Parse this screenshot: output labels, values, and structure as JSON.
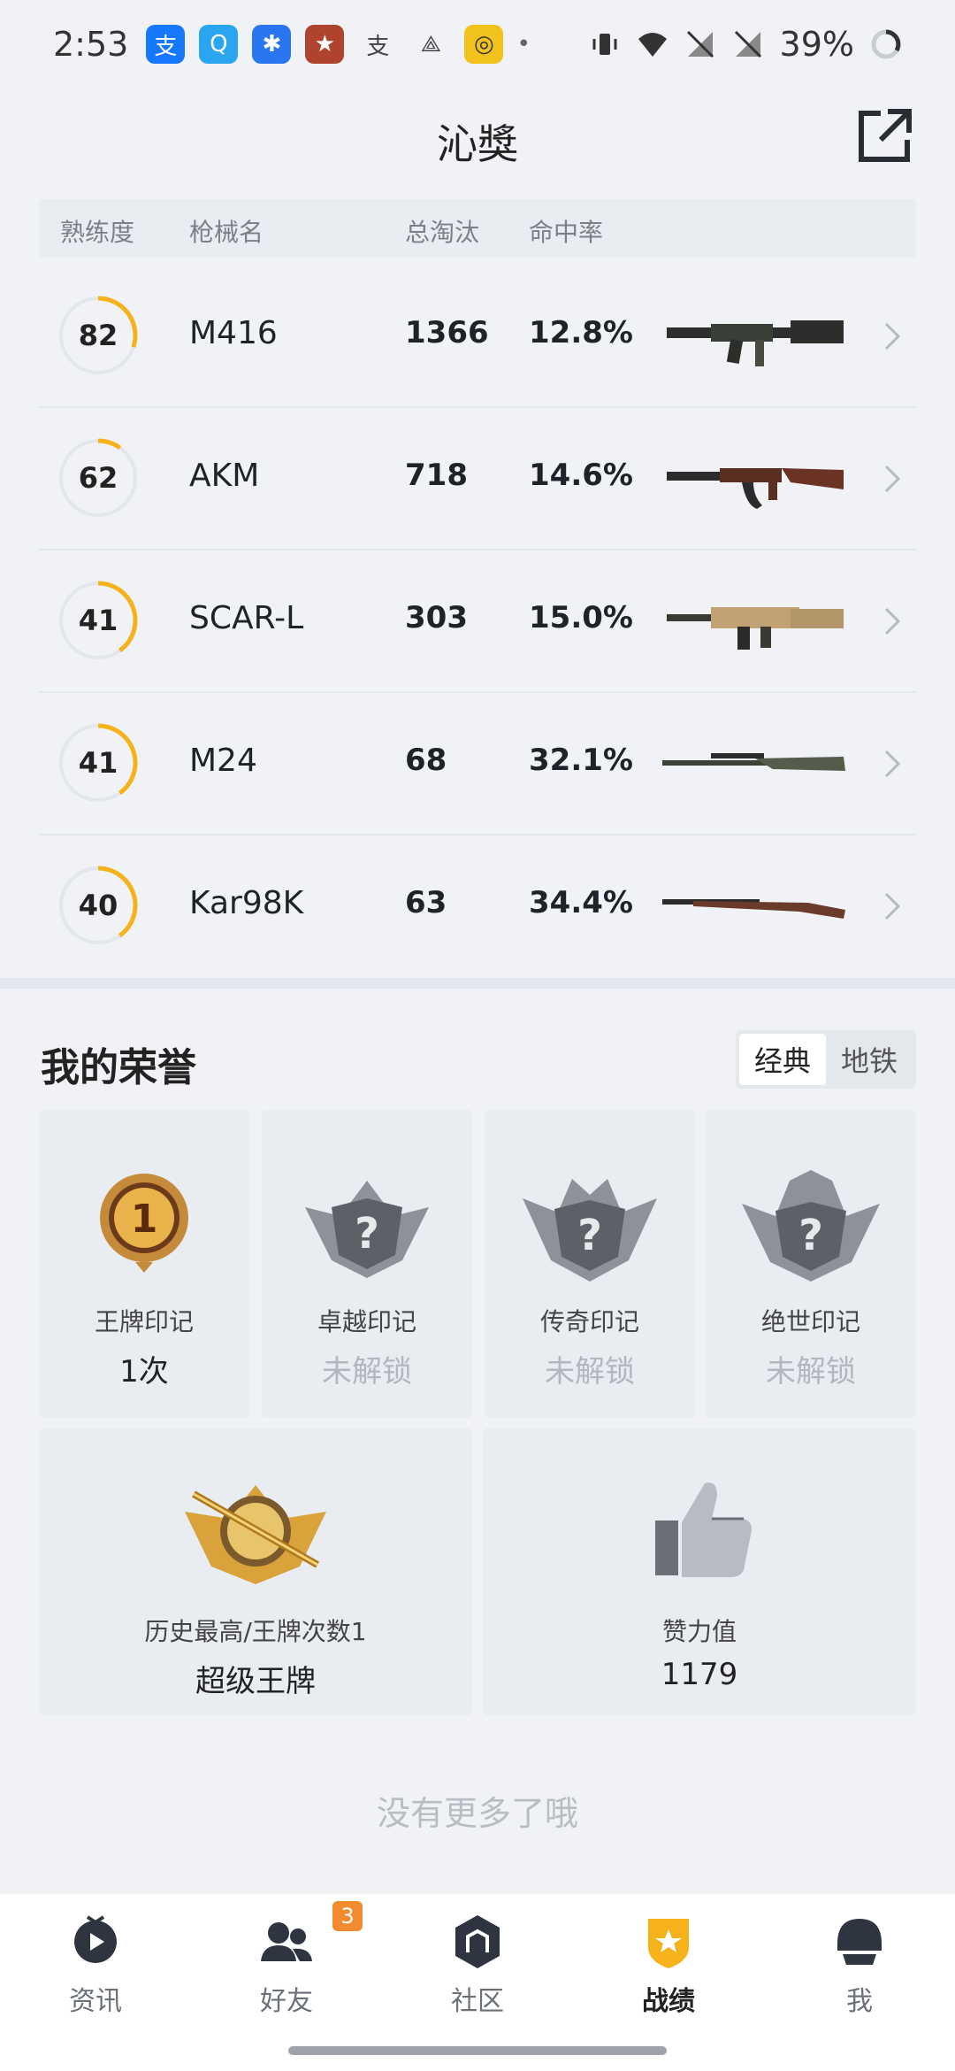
{
  "status_bar": {
    "time": "2:53",
    "battery": "39%"
  },
  "header": {
    "title": "沁獎"
  },
  "table": {
    "headers": {
      "proficiency": "熟练度",
      "gun_name": "枪械名",
      "total_kills": "总淘汰",
      "hit_rate": "命中率"
    },
    "rows": [
      {
        "proficiency": "82",
        "name": "M416",
        "kills": "1366",
        "rate": "12.8%",
        "ring_fraction": 0.3
      },
      {
        "proficiency": "62",
        "name": "AKM",
        "kills": "718",
        "rate": "14.6%",
        "ring_fraction": 0.1
      },
      {
        "proficiency": "41",
        "name": "SCAR-L",
        "kills": "303",
        "rate": "15.0%",
        "ring_fraction": 0.4
      },
      {
        "proficiency": "41",
        "name": "M24",
        "kills": "68",
        "rate": "32.1%",
        "ring_fraction": 0.4
      },
      {
        "proficiency": "40",
        "name": "Kar98K",
        "kills": "63",
        "rate": "34.4%",
        "ring_fraction": 0.4
      }
    ]
  },
  "honor": {
    "title": "我的荣誉",
    "tabs": [
      "经典",
      "地铁"
    ],
    "active_tab": "经典",
    "marks": [
      {
        "label": "王牌印记",
        "value": "1次",
        "locked": false
      },
      {
        "label": "卓越印记",
        "value": "未解锁",
        "locked": true
      },
      {
        "label": "传奇印记",
        "value": "未解锁",
        "locked": true
      },
      {
        "label": "绝世印记",
        "value": "未解锁",
        "locked": true
      }
    ],
    "highest": {
      "label": "历史最高/王牌次数1",
      "value": "超级王牌"
    },
    "likes": {
      "label": "赞力值",
      "value": "1179"
    }
  },
  "footer_text": "没有更多了哦",
  "bottom_nav": {
    "items": [
      {
        "label": "资讯",
        "icon": "news-icon"
      },
      {
        "label": "好友",
        "icon": "friends-icon",
        "badge": "3"
      },
      {
        "label": "社区",
        "icon": "community-icon"
      },
      {
        "label": "战绩",
        "icon": "record-icon",
        "active": true
      },
      {
        "label": "我",
        "icon": "profile-icon"
      }
    ]
  },
  "colors": {
    "accent": "#f5b21a",
    "background": "#f0f2f6",
    "card": "#e9ecf1",
    "badge": "#f28b30"
  }
}
